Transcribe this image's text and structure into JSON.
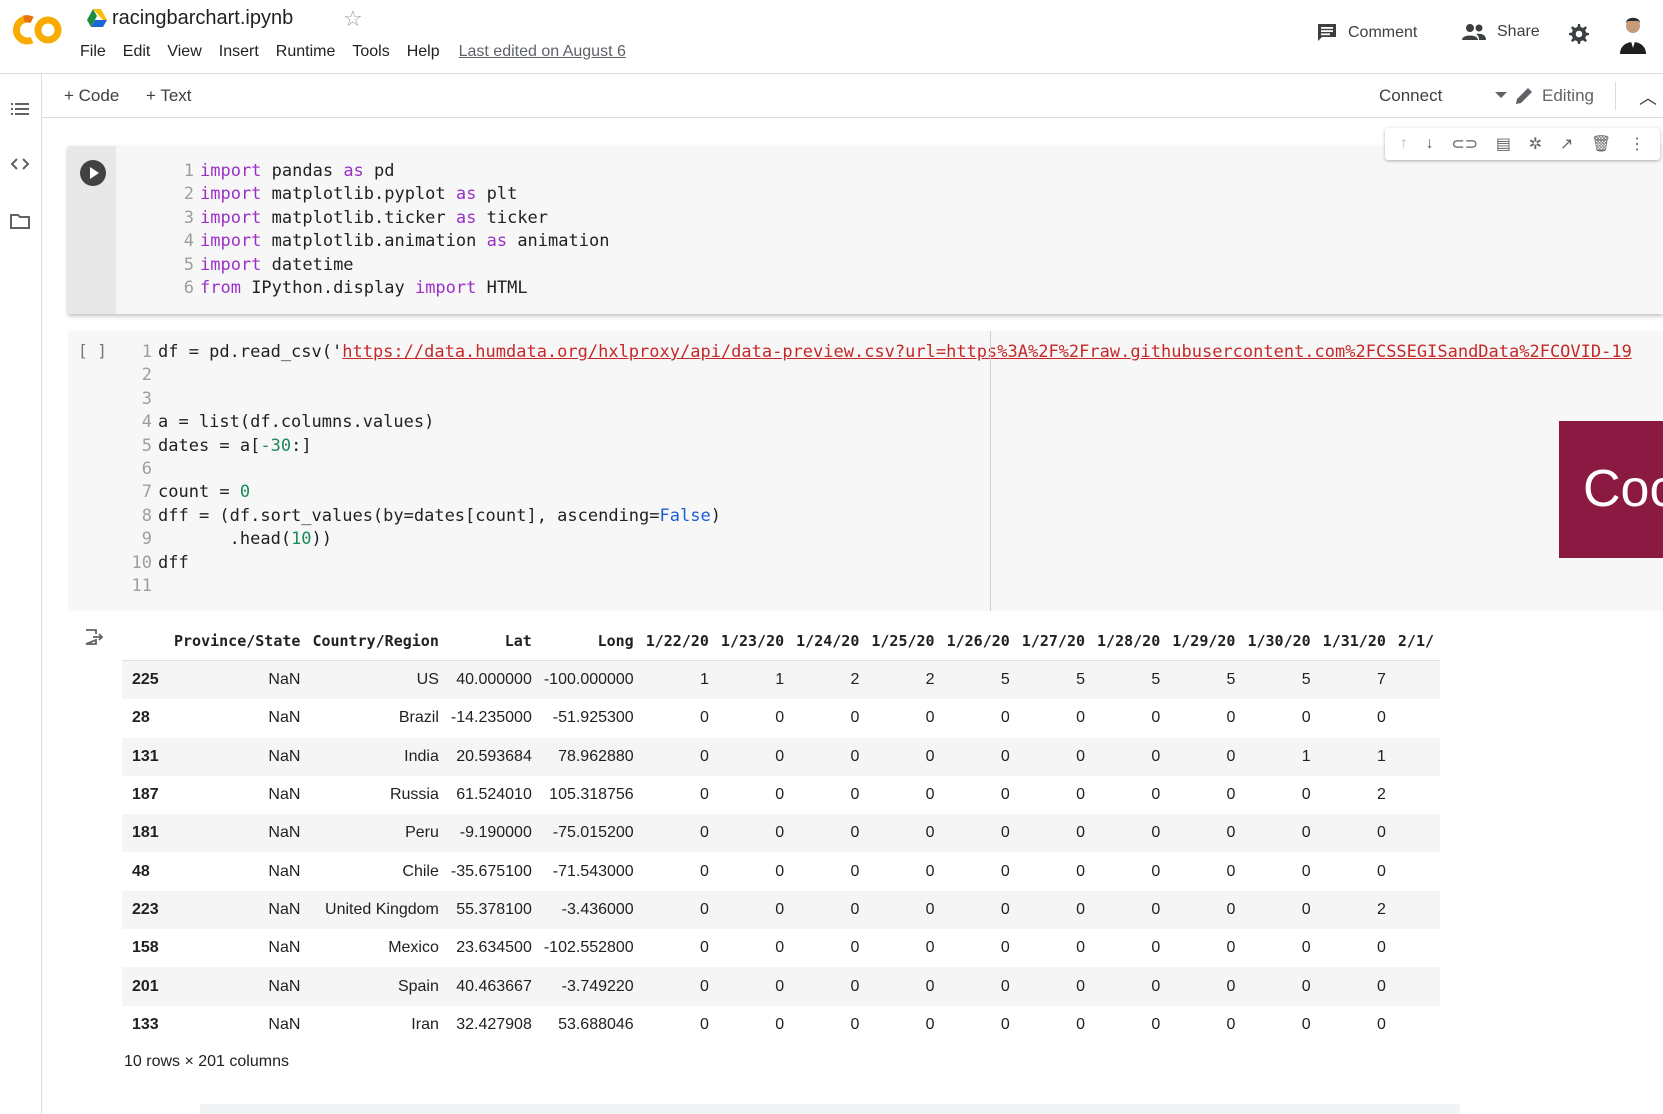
{
  "header": {
    "notebook_title": "racingbarchart.ipynb",
    "menu": [
      "File",
      "Edit",
      "View",
      "Insert",
      "Runtime",
      "Tools",
      "Help"
    ],
    "last_edited": "Last edited on August 6",
    "comment_label": "Comment",
    "share_label": "Share"
  },
  "toolbar": {
    "add_code": "+ Code",
    "add_text": "+ Text",
    "connect": "Connect",
    "editing": "Editing"
  },
  "cell1": {
    "lines": [
      [
        [
          "kw",
          "import"
        ],
        [
          "t",
          " pandas "
        ],
        [
          "kw",
          "as"
        ],
        [
          "t",
          " pd"
        ]
      ],
      [
        [
          "kw",
          "import"
        ],
        [
          "t",
          " matplotlib.pyplot "
        ],
        [
          "kw",
          "as"
        ],
        [
          "t",
          " plt"
        ]
      ],
      [
        [
          "kw",
          "import"
        ],
        [
          "t",
          " matplotlib.ticker "
        ],
        [
          "kw",
          "as"
        ],
        [
          "t",
          " ticker"
        ]
      ],
      [
        [
          "kw",
          "import"
        ],
        [
          "t",
          " matplotlib.animation "
        ],
        [
          "kw",
          "as"
        ],
        [
          "t",
          " animation"
        ]
      ],
      [
        [
          "kw",
          "import"
        ],
        [
          "t",
          " datetime"
        ]
      ],
      [
        [
          "kw",
          "from"
        ],
        [
          "t",
          " IPython.display "
        ],
        [
          "kw",
          "import"
        ],
        [
          "t",
          " HTML"
        ]
      ]
    ]
  },
  "cell2": {
    "bracket": "[ ]",
    "lines": [
      [
        [
          "t",
          "df = pd.read_csv('"
        ],
        [
          "url",
          "https://data.humdata.org/hxlproxy/api/data-preview.csv?url=https%3A%2F%2Fraw.githubusercontent.com%2FCSSEGISandData%2FCOVID-19"
        ]
      ],
      [],
      [],
      [
        [
          "t",
          "a = list(df.columns.values)"
        ]
      ],
      [
        [
          "t",
          "dates = a["
        ],
        [
          "num",
          "-30"
        ],
        [
          "t",
          ":]"
        ]
      ],
      [],
      [
        [
          "t",
          "count = "
        ],
        [
          "num",
          "0"
        ]
      ],
      [
        [
          "t",
          "dff = (df.sort_values(by=dates[count], ascending="
        ],
        [
          "bool",
          "False"
        ],
        [
          "t",
          ")"
        ]
      ],
      [
        [
          "t",
          "       .head("
        ],
        [
          "num",
          "10"
        ],
        [
          "t",
          "))"
        ]
      ],
      [
        [
          "t",
          "dff"
        ]
      ],
      []
    ]
  },
  "overlay_text": "Coc",
  "output": {
    "columns": [
      "",
      "Province/State",
      "Country/Region",
      "Lat",
      "Long",
      "1/22/20",
      "1/23/20",
      "1/24/20",
      "1/25/20",
      "1/26/20",
      "1/27/20",
      "1/28/20",
      "1/29/20",
      "1/30/20",
      "1/31/20",
      "2/1/"
    ],
    "rows": [
      [
        "225",
        "NaN",
        "US",
        "40.000000",
        "-100.000000",
        "1",
        "1",
        "2",
        "2",
        "5",
        "5",
        "5",
        "5",
        "5",
        "7",
        ""
      ],
      [
        "28",
        "NaN",
        "Brazil",
        "-14.235000",
        "-51.925300",
        "0",
        "0",
        "0",
        "0",
        "0",
        "0",
        "0",
        "0",
        "0",
        "0",
        ""
      ],
      [
        "131",
        "NaN",
        "India",
        "20.593684",
        "78.962880",
        "0",
        "0",
        "0",
        "0",
        "0",
        "0",
        "0",
        "0",
        "1",
        "1",
        ""
      ],
      [
        "187",
        "NaN",
        "Russia",
        "61.524010",
        "105.318756",
        "0",
        "0",
        "0",
        "0",
        "0",
        "0",
        "0",
        "0",
        "0",
        "2",
        ""
      ],
      [
        "181",
        "NaN",
        "Peru",
        "-9.190000",
        "-75.015200",
        "0",
        "0",
        "0",
        "0",
        "0",
        "0",
        "0",
        "0",
        "0",
        "0",
        ""
      ],
      [
        "48",
        "NaN",
        "Chile",
        "-35.675100",
        "-71.543000",
        "0",
        "0",
        "0",
        "0",
        "0",
        "0",
        "0",
        "0",
        "0",
        "0",
        ""
      ],
      [
        "223",
        "NaN",
        "United Kingdom",
        "55.378100",
        "-3.436000",
        "0",
        "0",
        "0",
        "0",
        "0",
        "0",
        "0",
        "0",
        "0",
        "2",
        ""
      ],
      [
        "158",
        "NaN",
        "Mexico",
        "23.634500",
        "-102.552800",
        "0",
        "0",
        "0",
        "0",
        "0",
        "0",
        "0",
        "0",
        "0",
        "0",
        ""
      ],
      [
        "201",
        "NaN",
        "Spain",
        "40.463667",
        "-3.749220",
        "0",
        "0",
        "0",
        "0",
        "0",
        "0",
        "0",
        "0",
        "0",
        "0",
        ""
      ],
      [
        "133",
        "NaN",
        "Iran",
        "32.427908",
        "53.688046",
        "0",
        "0",
        "0",
        "0",
        "0",
        "0",
        "0",
        "0",
        "0",
        "0",
        ""
      ]
    ],
    "shape": "10 rows × 201 columns"
  },
  "colors": {
    "keyword": "#9b30c8",
    "string": "#c62828",
    "number": "#1b8a5a",
    "boolean": "#1a5fd0",
    "overlay": "#8b1a43",
    "colab_orange": "#f9ab00"
  }
}
